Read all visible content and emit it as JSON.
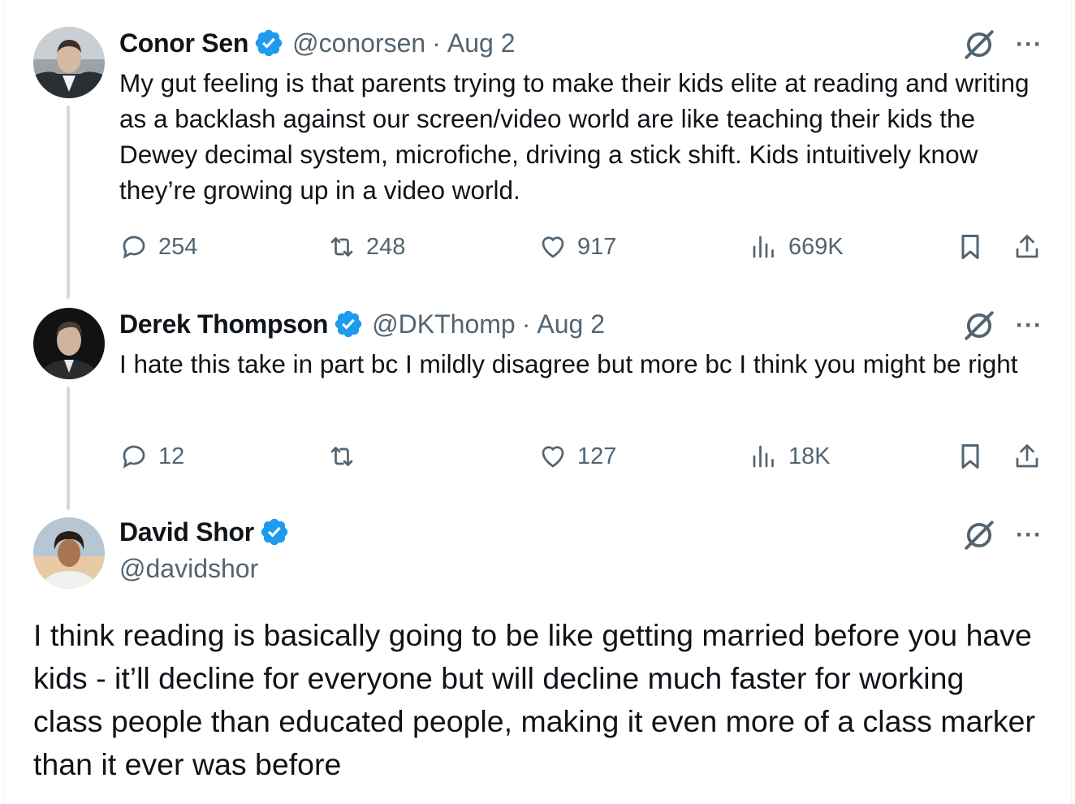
{
  "colors": {
    "verified_badge": "#1d9bf0",
    "secondary_text": "#536471",
    "thread_line": "#cfd9de"
  },
  "tweets": [
    {
      "name": "Conor Sen",
      "handle": "@conorsen",
      "separator": "·",
      "date": "Aug 2",
      "text": "My gut feeling is that parents trying to make their kids elite at reading and writing as a backlash against our screen/video world are like teaching their kids the Dewey decimal system, microfiche, driving a stick shift. Kids intuitively know they’re growing up in a video world.",
      "replies": "254",
      "reposts": "248",
      "likes": "917",
      "views": "669K"
    },
    {
      "name": "Derek Thompson",
      "handle": "@DKThomp",
      "separator": "·",
      "date": "Aug 2",
      "text": "I hate this take in part bc I mildly disagree but more bc I think you might be right",
      "replies": "12",
      "reposts": "",
      "likes": "127",
      "views": "18K"
    }
  ],
  "main_tweet": {
    "name": "David Shor",
    "handle": "@davidshor",
    "text": "I think reading is basically going to be like getting married before you have kids - it’ll decline for everyone but will decline much faster for working class people than educated people, making it even more of a class marker than it ever was before"
  },
  "icons": {
    "more": "···"
  }
}
